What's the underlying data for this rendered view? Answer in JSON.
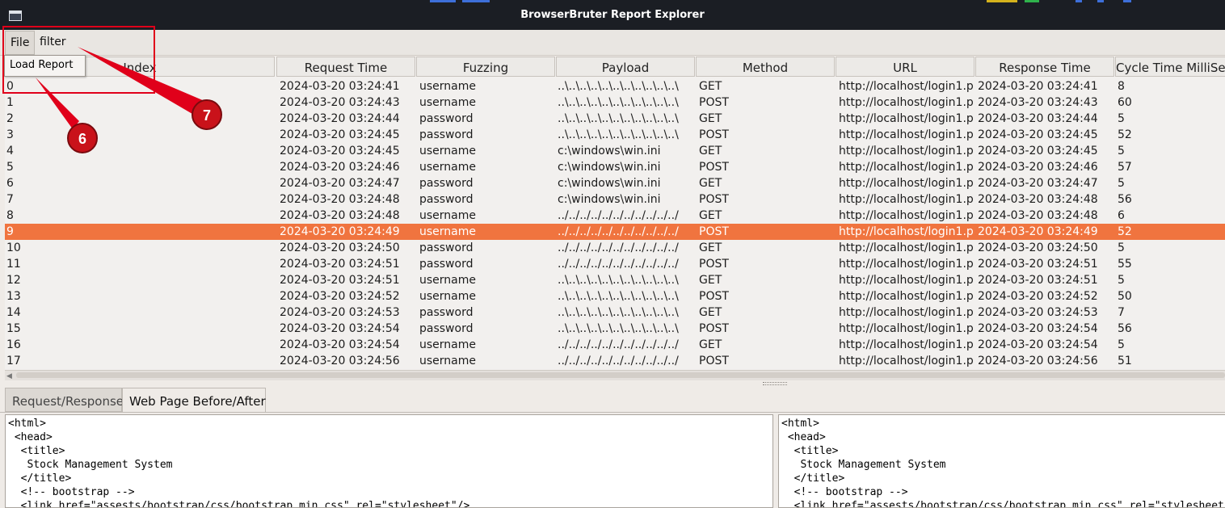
{
  "window": {
    "title": "BrowserBruter Report Explorer"
  },
  "menubar": {
    "items": [
      {
        "label": "File"
      },
      {
        "label": "filter"
      }
    ]
  },
  "file_menu": {
    "items": [
      {
        "label": "Load Report"
      }
    ]
  },
  "table": {
    "columns": [
      "Index",
      "Request Time",
      "Fuzzing",
      "Payload",
      "Method",
      "URL",
      "Response Time",
      "Cycle Time MilliSeco"
    ],
    "selected_index": 9,
    "rows": [
      [
        "0",
        "2024-03-20 03:24:41",
        "username",
        "..\\..\\..\\..\\..\\..\\..\\..\\..\\..\\..\\",
        "GET",
        "http://localhost/login1.p",
        "2024-03-20 03:24:41",
        "8"
      ],
      [
        "1",
        "2024-03-20 03:24:43",
        "username",
        "..\\..\\..\\..\\..\\..\\..\\..\\..\\..\\..\\",
        "POST",
        "http://localhost/login1.p",
        "2024-03-20 03:24:43",
        "60"
      ],
      [
        "2",
        "2024-03-20 03:24:44",
        "password",
        "..\\..\\..\\..\\..\\..\\..\\..\\..\\..\\..\\",
        "GET",
        "http://localhost/login1.p",
        "2024-03-20 03:24:44",
        "5"
      ],
      [
        "3",
        "2024-03-20 03:24:45",
        "password",
        "..\\..\\..\\..\\..\\..\\..\\..\\..\\..\\..\\",
        "POST",
        "http://localhost/login1.p",
        "2024-03-20 03:24:45",
        "52"
      ],
      [
        "4",
        "2024-03-20 03:24:45",
        "username",
        "c:\\windows\\win.ini",
        "GET",
        "http://localhost/login1.p",
        "2024-03-20 03:24:45",
        "5"
      ],
      [
        "5",
        "2024-03-20 03:24:46",
        "username",
        "c:\\windows\\win.ini",
        "POST",
        "http://localhost/login1.p",
        "2024-03-20 03:24:46",
        "57"
      ],
      [
        "6",
        "2024-03-20 03:24:47",
        "password",
        "c:\\windows\\win.ini",
        "GET",
        "http://localhost/login1.p",
        "2024-03-20 03:24:47",
        "5"
      ],
      [
        "7",
        "2024-03-20 03:24:48",
        "password",
        "c:\\windows\\win.ini",
        "POST",
        "http://localhost/login1.p",
        "2024-03-20 03:24:48",
        "56"
      ],
      [
        "8",
        "2024-03-20 03:24:48",
        "username",
        "../../../../../../../../../../../",
        "GET",
        "http://localhost/login1.p",
        "2024-03-20 03:24:48",
        "6"
      ],
      [
        "9",
        "2024-03-20 03:24:49",
        "username",
        "../../../../../../../../../../../",
        "POST",
        "http://localhost/login1.p",
        "2024-03-20 03:24:49",
        "52"
      ],
      [
        "10",
        "2024-03-20 03:24:50",
        "password",
        "../../../../../../../../../../../",
        "GET",
        "http://localhost/login1.p",
        "2024-03-20 03:24:50",
        "5"
      ],
      [
        "11",
        "2024-03-20 03:24:51",
        "password",
        "../../../../../../../../../../../",
        "POST",
        "http://localhost/login1.p",
        "2024-03-20 03:24:51",
        "55"
      ],
      [
        "12",
        "2024-03-20 03:24:51",
        "username",
        "..\\..\\..\\..\\..\\..\\..\\..\\..\\..\\..\\",
        "GET",
        "http://localhost/login1.p",
        "2024-03-20 03:24:51",
        "5"
      ],
      [
        "13",
        "2024-03-20 03:24:52",
        "username",
        "..\\..\\..\\..\\..\\..\\..\\..\\..\\..\\..\\",
        "POST",
        "http://localhost/login1.p",
        "2024-03-20 03:24:52",
        "50"
      ],
      [
        "14",
        "2024-03-20 03:24:53",
        "password",
        "..\\..\\..\\..\\..\\..\\..\\..\\..\\..\\..\\",
        "GET",
        "http://localhost/login1.p",
        "2024-03-20 03:24:53",
        "7"
      ],
      [
        "15",
        "2024-03-20 03:24:54",
        "password",
        "..\\..\\..\\..\\..\\..\\..\\..\\..\\..\\..\\",
        "POST",
        "http://localhost/login1.p",
        "2024-03-20 03:24:54",
        "56"
      ],
      [
        "16",
        "2024-03-20 03:24:54",
        "username",
        "../../../../../../../../../../../",
        "GET",
        "http://localhost/login1.p",
        "2024-03-20 03:24:54",
        "5"
      ],
      [
        "17",
        "2024-03-20 03:24:56",
        "username",
        "../../../../../../../../../../../",
        "POST",
        "http://localhost/login1.p",
        "2024-03-20 03:24:56",
        "51"
      ]
    ]
  },
  "tabs": [
    {
      "label": "Request/Response",
      "active": false
    },
    {
      "label": "Web Page Before/After",
      "active": true
    }
  ],
  "panes": {
    "before": "<html>\n <head>\n  <title>\n   Stock Management System\n  </title>\n  <!-- bootstrap -->\n  <link href=\"assests/bootstrap/css/bootstrap.min.css\" rel=\"stylesheet\"/>",
    "after": "<html>\n <head>\n  <title>\n   Stock Management System\n  </title>\n  <!-- bootstrap -->\n  <link href=\"assests/bootstrap/css/bootstrap.min.css\" rel=\"stylesheet\"/>"
  },
  "annotations": [
    {
      "label": "6",
      "color": "#e0001a"
    },
    {
      "label": "7",
      "color": "#e0001a"
    }
  ],
  "colors": {
    "selection": "#f0743f",
    "titlebar": "#1b1e24",
    "annotation": "#e0001a"
  },
  "icons": {
    "window_icon": "window-icon"
  }
}
